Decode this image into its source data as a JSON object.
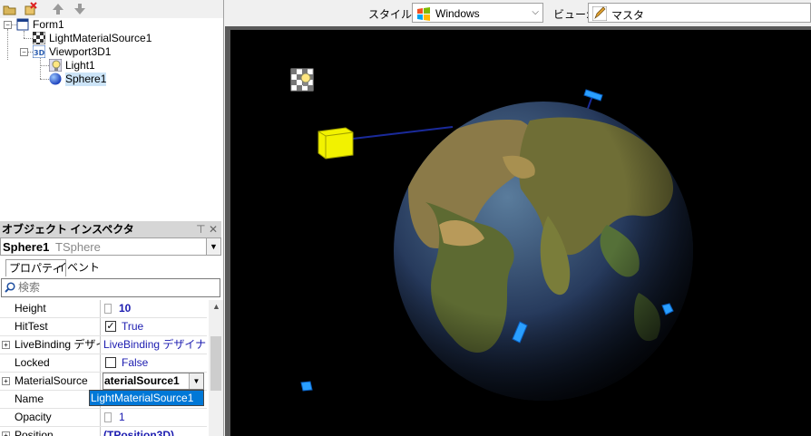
{
  "tree": {
    "items": [
      {
        "label": "Form1",
        "icon": "form-icon"
      },
      {
        "label": "LightMaterialSource1",
        "icon": "material-icon"
      },
      {
        "label": "Viewport3D1",
        "icon": "viewport-icon"
      },
      {
        "label": "Light1",
        "icon": "light-icon"
      },
      {
        "label": "Sphere1",
        "icon": "sphere-icon"
      }
    ]
  },
  "inspector": {
    "title": "オブジェクト インスペクタ",
    "object_name": "Sphere1",
    "object_type": "TSphere",
    "tabs": [
      "プロパティ",
      "イベント"
    ],
    "search_placeholder": "検索",
    "properties": [
      {
        "name": "Height",
        "value": "10"
      },
      {
        "name": "HitTest",
        "value": "True"
      },
      {
        "name": "LiveBinding デザイナ",
        "value": "LiveBinding デザイナ"
      },
      {
        "name": "Locked",
        "value": "False"
      },
      {
        "name": "MaterialSource",
        "value": "aterialSource1"
      },
      {
        "name": "Name",
        "value": ""
      },
      {
        "name": "Opacity",
        "value": "1"
      },
      {
        "name": "Position",
        "value": "(TPosition3D)"
      }
    ],
    "dropdown_selected": "LightMaterialSource1"
  },
  "designer": {
    "style_label": "スタイル:",
    "style_value": "Windows",
    "view_label": "ビュー:",
    "view_value": "マスタ"
  },
  "colors": {
    "selection": "#0078d7",
    "viewport_bg": "#000000",
    "value_text": "#1c1cb0"
  }
}
